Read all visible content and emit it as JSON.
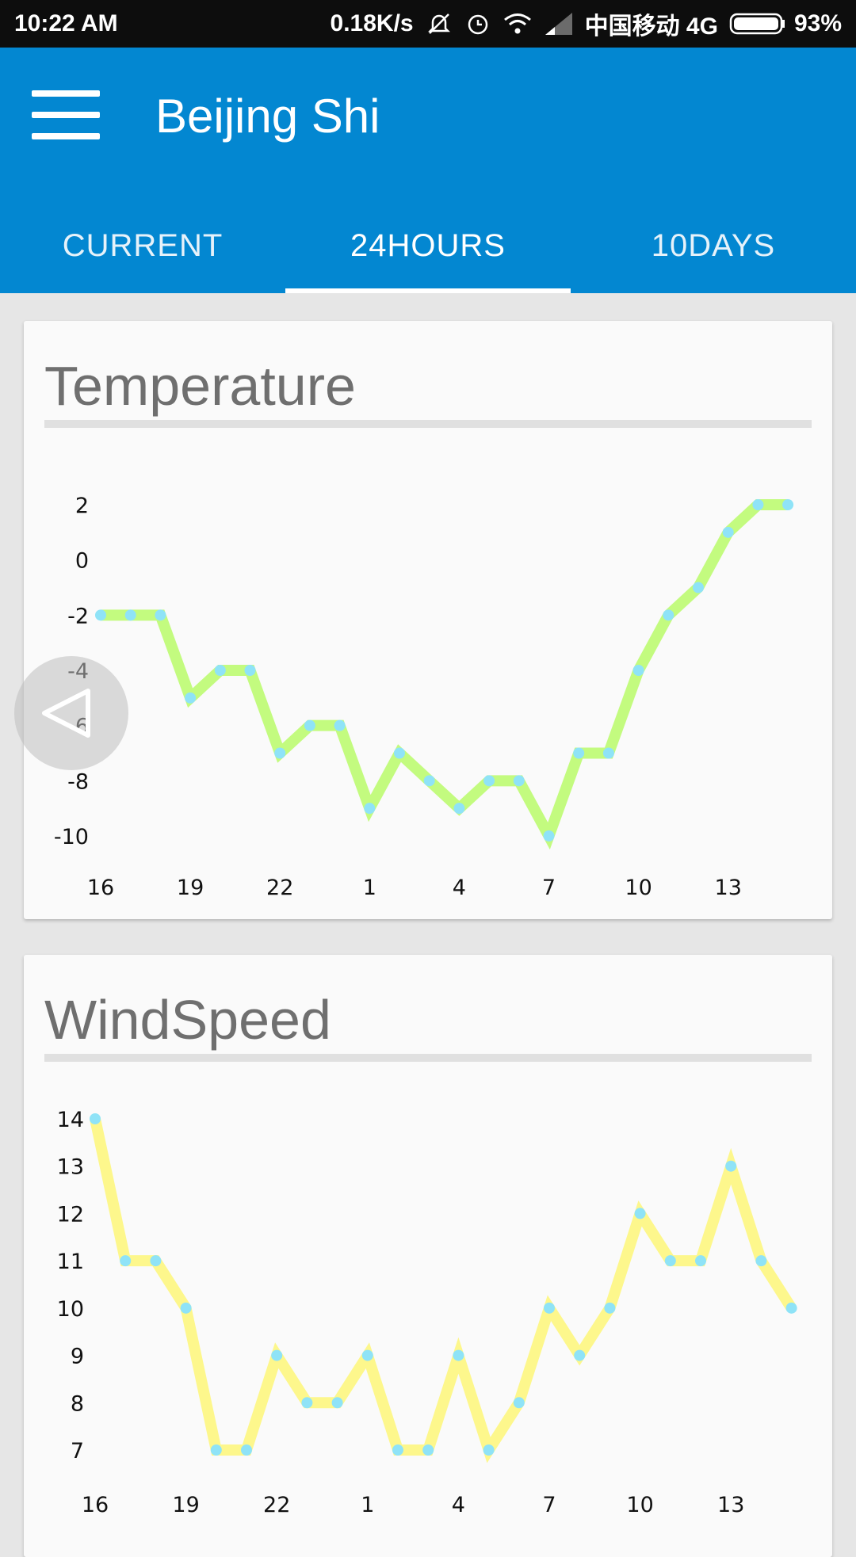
{
  "status_bar": {
    "time": "10:22 AM",
    "net_speed": "0.18K/s",
    "carrier": "中国移动 4G",
    "battery": "93%",
    "icons": [
      "mute-icon",
      "alarm-icon",
      "wifi-icon",
      "signal-icon",
      "battery-icon"
    ]
  },
  "app_bar": {
    "title": "Beijing Shi",
    "color": "#0387d1",
    "tabs": [
      {
        "label": "CURRENT"
      },
      {
        "label": "24HOURS",
        "selected": true
      },
      {
        "label": "10DAYS"
      }
    ]
  },
  "cards": {
    "temperature": {
      "title": "Temperature"
    },
    "windspeed": {
      "title": "WindSpeed"
    }
  },
  "chart_data": [
    {
      "type": "line",
      "title": "Temperature",
      "x": [
        16,
        17,
        18,
        19,
        20,
        21,
        22,
        23,
        0,
        1,
        2,
        3,
        4,
        5,
        6,
        7,
        8,
        9,
        10,
        11,
        12,
        13,
        14,
        15
      ],
      "x_ticks": [
        "16",
        "19",
        "22",
        "1",
        "4",
        "7",
        "10",
        "13"
      ],
      "y_ticks": [
        "2",
        "0",
        "-2",
        "-4",
        "-6",
        "-8",
        "-10"
      ],
      "values": [
        -2,
        -2,
        -2,
        -5,
        -4,
        -4,
        -7,
        -6,
        -6,
        -9,
        -7,
        -8,
        -9,
        -8,
        -8,
        -10,
        -7,
        -7,
        -4,
        -2,
        -1,
        1,
        2,
        2
      ],
      "ylim": [
        -10,
        2
      ],
      "line_color": "#c3fb7f",
      "point_color": "#8fe3f7",
      "grid": false
    },
    {
      "type": "line",
      "title": "WindSpeed",
      "x": [
        16,
        17,
        18,
        19,
        20,
        21,
        22,
        23,
        0,
        1,
        2,
        3,
        4,
        5,
        6,
        7,
        8,
        9,
        10,
        11,
        12,
        13,
        14,
        15
      ],
      "x_ticks": [
        "16",
        "19",
        "22",
        "1",
        "4",
        "7",
        "10",
        "13"
      ],
      "y_ticks": [
        "14",
        "13",
        "12",
        "11",
        "10",
        "9",
        "8",
        "7"
      ],
      "values": [
        14,
        11,
        11,
        10,
        7,
        7,
        9,
        8,
        8,
        9,
        7,
        7,
        9,
        7,
        8,
        10,
        9,
        10,
        12,
        11,
        11,
        13,
        11,
        10
      ],
      "ylim": [
        7,
        14
      ],
      "line_color": "#fdf78c",
      "point_color": "#8fe3f7",
      "grid": false
    }
  ]
}
